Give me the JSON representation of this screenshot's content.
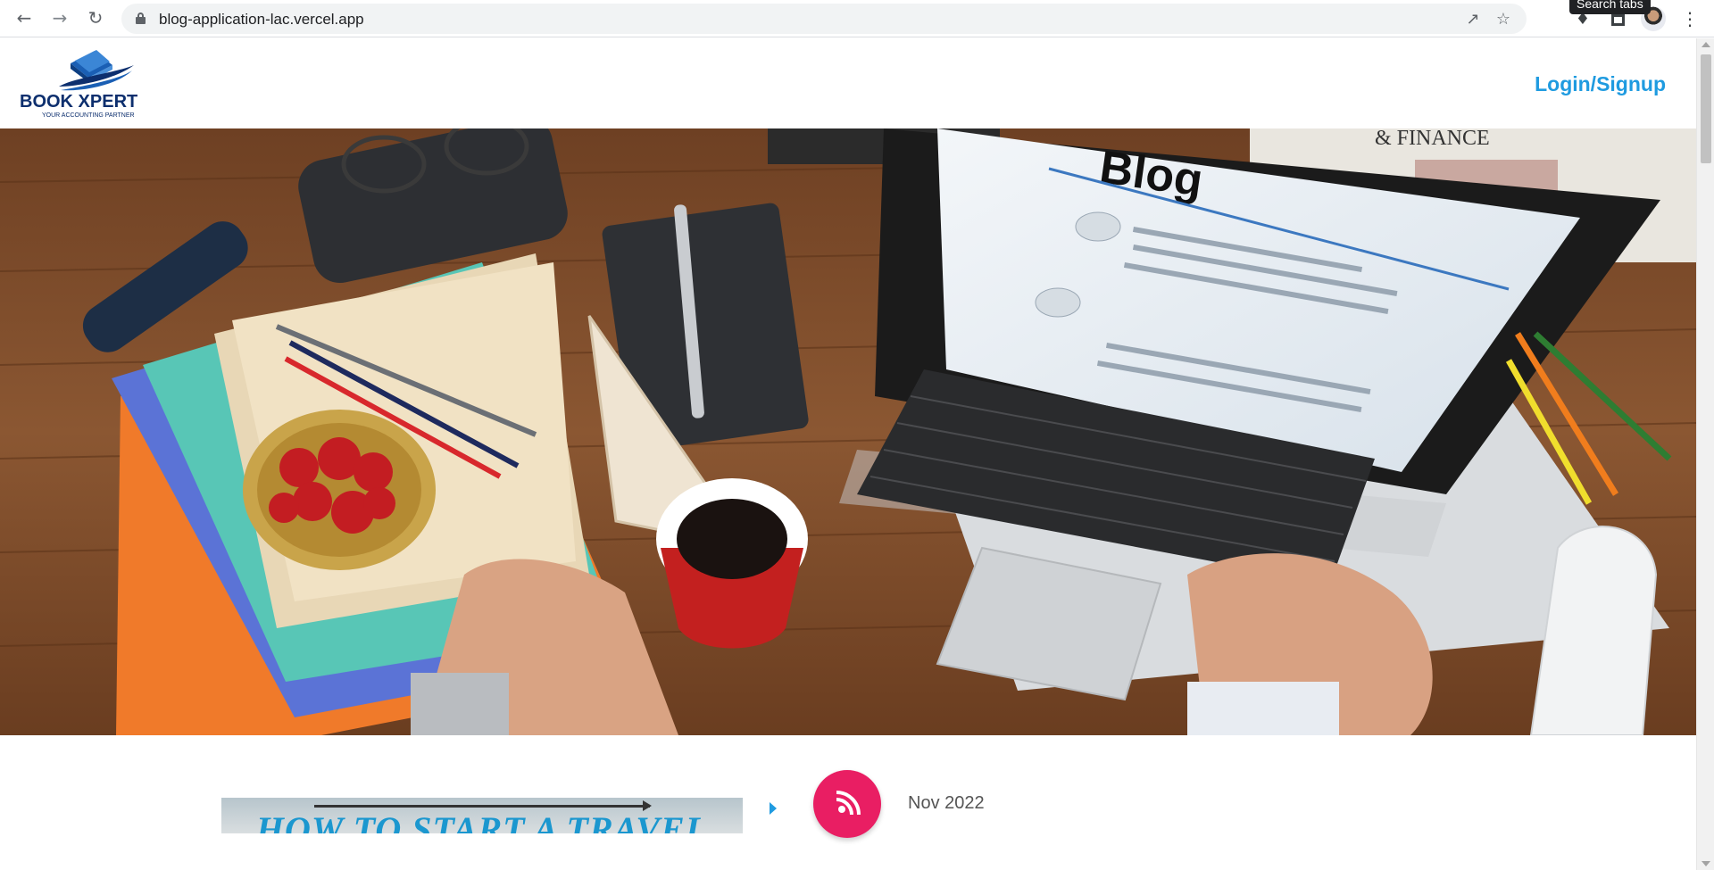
{
  "browser": {
    "url": "blog-application-lac.vercel.app",
    "tooltip": "Search tabs",
    "icons": {
      "back": "back-arrow-icon",
      "forward": "forward-arrow-icon",
      "reload": "reload-icon",
      "lock": "lock-icon",
      "share": "share-icon",
      "bookmark": "star-icon",
      "extensions": "puzzle-icon",
      "tab_search": "window-icon",
      "profile": "avatar",
      "menu": "kebab-menu-icon"
    }
  },
  "header": {
    "logo_text": "BOOK XPERT",
    "logo_tagline": "YOUR ACCOUNTING PARTNER",
    "login_label": "Login/Signup"
  },
  "hero": {
    "screen_text": "Blog",
    "newspaper_text": "& FINANCE"
  },
  "post": {
    "thumbnail_title": "HOW TO START A TRAVEL BLOG",
    "date": "Nov 2022",
    "icon": "feed-icon"
  },
  "colors": {
    "brand_blue": "#1f9be0",
    "feed_pink": "#e91e63",
    "logo_blue": "#1a5fb4"
  }
}
